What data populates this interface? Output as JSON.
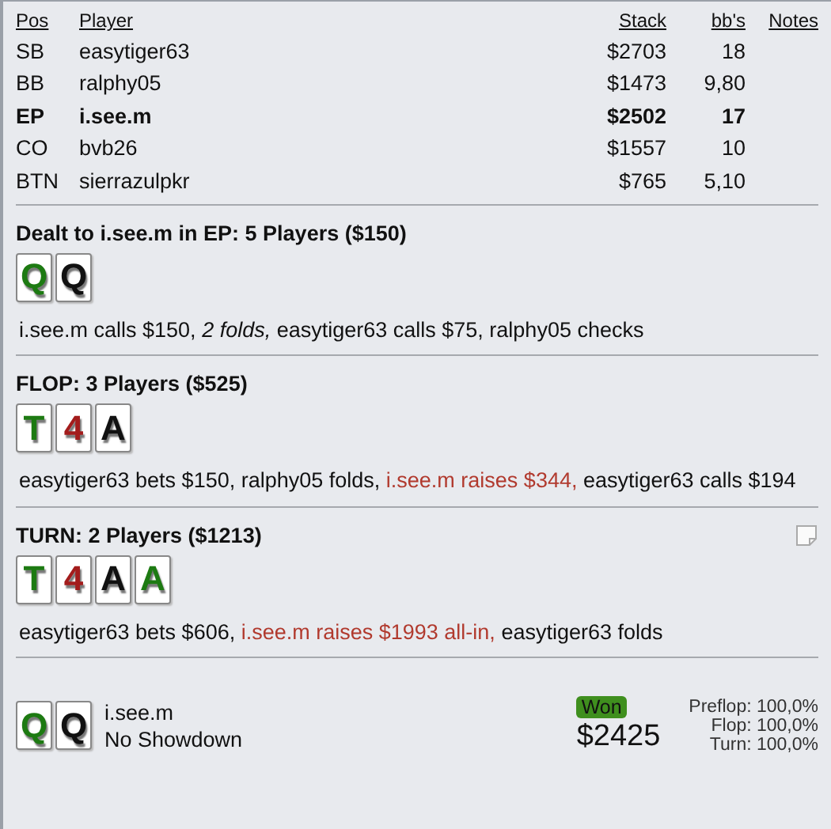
{
  "players": {
    "columns": [
      {
        "label": "Pos"
      },
      {
        "label": "Player"
      },
      {
        "label": "Stack"
      },
      {
        "label": "bb's"
      },
      {
        "label": "Notes"
      }
    ],
    "rows": [
      {
        "pos": "SB",
        "player": "easytiger63",
        "stack": "$2703",
        "bbs": "18",
        "highlighted": false
      },
      {
        "pos": "BB",
        "player": "ralphy05",
        "stack": "$1473",
        "bbs": "9,80",
        "highlighted": false
      },
      {
        "pos": "EP",
        "player": "i.see.m",
        "stack": "$2502",
        "bbs": "17",
        "highlighted": true
      },
      {
        "pos": "CO",
        "player": "bvb26",
        "stack": "$1557",
        "bbs": "10",
        "highlighted": false
      },
      {
        "pos": "BTN",
        "player": "sierrazulpkr",
        "stack": "$765",
        "bbs": "5,10",
        "highlighted": false
      }
    ]
  },
  "streets": [
    {
      "title": "Dealt to i.see.m in EP: 5 Players ($150)",
      "note_icon": false,
      "cards": [
        {
          "rank": "Q",
          "color": "#1d7a12"
        },
        {
          "rank": "Q",
          "color": "#111111"
        }
      ],
      "actions": [
        {
          "text": "i.see.m calls $150, ",
          "kind": "plain"
        },
        {
          "text": "2 folds,",
          "kind": "italic"
        },
        {
          "text": " easytiger63 calls $75, ralphy05 checks",
          "kind": "plain"
        }
      ]
    },
    {
      "title": "FLOP: 3 Players ($525)",
      "note_icon": false,
      "cards": [
        {
          "rank": "T",
          "color": "#1d7a12"
        },
        {
          "rank": "4",
          "color": "#a31c1c"
        },
        {
          "rank": "A",
          "color": "#111111"
        }
      ],
      "actions": [
        {
          "text": "easytiger63 bets $150, ralphy05 folds, ",
          "kind": "plain"
        },
        {
          "text": "i.see.m raises $344,",
          "kind": "hero"
        },
        {
          "text": " easytiger63 calls $194",
          "kind": "plain"
        }
      ]
    },
    {
      "title": "TURN: 2 Players ($1213)",
      "note_icon": true,
      "cards": [
        {
          "rank": "T",
          "color": "#1d7a12"
        },
        {
          "rank": "4",
          "color": "#a31c1c"
        },
        {
          "rank": "A",
          "color": "#111111"
        },
        {
          "rank": "A",
          "color": "#1d7a12"
        }
      ],
      "actions": [
        {
          "text": "easytiger63 bets $606, ",
          "kind": "plain"
        },
        {
          "text": "i.see.m raises $1993 all-in,",
          "kind": "hero"
        },
        {
          "text": " easytiger63 folds",
          "kind": "plain"
        }
      ]
    }
  ],
  "result": {
    "cards": [
      {
        "rank": "Q",
        "color": "#1d7a12"
      },
      {
        "rank": "Q",
        "color": "#111111"
      }
    ],
    "player": "i.see.m",
    "outcome": "No Showdown",
    "badge": "Won",
    "amount": "$2425",
    "equity": [
      {
        "label": "Preflop:",
        "value": "100,0%"
      },
      {
        "label": "Flop:",
        "value": "100,0%"
      },
      {
        "label": "Turn:",
        "value": "100,0%"
      }
    ]
  }
}
